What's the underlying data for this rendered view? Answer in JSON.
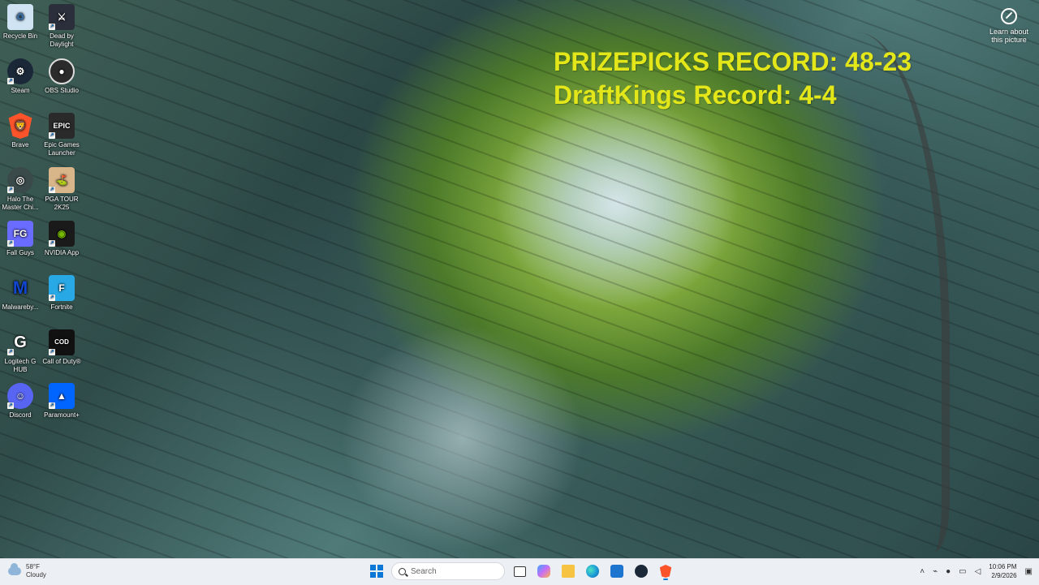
{
  "overlay": {
    "line1": "PRIZEPICKS RECORD: 48-23",
    "line2": "DraftKings Record: 4-4",
    "color": "#e3e71a"
  },
  "learn_picture": {
    "label": "Learn about this picture"
  },
  "desktop_icons": [
    {
      "label": "Recycle Bin",
      "icon": "recycle-bin-icon",
      "color": "#cfe3f3"
    },
    {
      "label": "Dead by Daylight",
      "icon": "dead-by-daylight-icon",
      "color": "#2b2f3b"
    },
    {
      "label": "Steam",
      "icon": "steam-icon",
      "color": "#1b2838"
    },
    {
      "label": "OBS Studio",
      "icon": "obs-studio-icon",
      "color": "#2b2b2b"
    },
    {
      "label": "Brave",
      "icon": "brave-icon",
      "color": "#fb542b"
    },
    {
      "label": "Epic Games Launcher",
      "icon": "epic-games-icon",
      "color": "#2a2a2a"
    },
    {
      "label": "Halo The Master Chi...",
      "icon": "halo-icon",
      "color": "#3a4a4a"
    },
    {
      "label": "PGA TOUR 2K25",
      "icon": "pga-tour-icon",
      "color": "#d9b58a"
    },
    {
      "label": "Fall Guys",
      "icon": "fall-guys-icon",
      "color": "#6a6cff"
    },
    {
      "label": "NVIDIA App",
      "icon": "nvidia-icon",
      "color": "#1a1a1a"
    },
    {
      "label": "Malwareby...",
      "icon": "malwarebytes-icon",
      "color": "#1146d1"
    },
    {
      "label": "Fortnite",
      "icon": "fortnite-icon",
      "color": "#28a9e6"
    },
    {
      "label": "Logitech G HUB",
      "icon": "logitech-g-hub-icon",
      "color": "#111111"
    },
    {
      "label": "Call of Duty®",
      "icon": "call-of-duty-icon",
      "color": "#111111"
    },
    {
      "label": "Discord",
      "icon": "discord-icon",
      "color": "#5865f2"
    },
    {
      "label": "Paramount+",
      "icon": "paramount-plus-icon",
      "color": "#0064ff"
    }
  ],
  "taskbar": {
    "weather_temp": "58°F",
    "weather_desc": "Cloudy",
    "search_placeholder": "Search",
    "time": "10:06 PM",
    "date": "2/9/2026",
    "accent": "#0a78d4"
  }
}
